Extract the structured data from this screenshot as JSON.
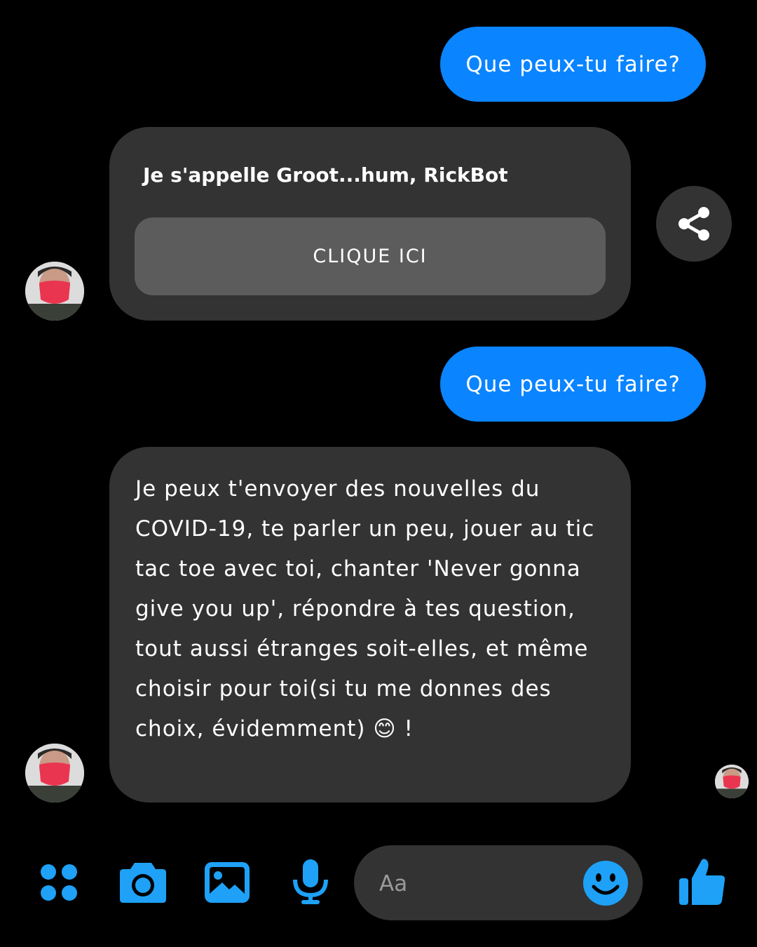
{
  "messages": {
    "sent_1": "Que peux-tu faire?",
    "card": {
      "title": "Je s'appelle Groot...hum, RickBot",
      "button_label": "CLIQUE ICI"
    },
    "sent_2": "Que peux-tu faire?",
    "reply": {
      "text": "Je peux t'envoyer des nouvelles du COVID-19, te parler un peu, jouer au tic tac toe avec toi, chanter 'Never gonna give you up', répondre à tes question, tout aussi étranges soit-elles, et même choisir pour toi(si tu me donnes des choix, évidemment) 😊 !"
    }
  },
  "composer": {
    "placeholder": "Aa"
  },
  "colors": {
    "background": "#000000",
    "sent_bubble": "#0a84ff",
    "received_bubble": "#333333",
    "card_button": "#5c5c5c",
    "icon_accent": "#1ea1f7"
  },
  "icons": {
    "share": "share-icon",
    "apps": "apps-grid-icon",
    "camera": "camera-icon",
    "gallery": "image-icon",
    "microphone": "microphone-icon",
    "emoji": "smiley-icon",
    "like": "thumbs-up-icon"
  }
}
